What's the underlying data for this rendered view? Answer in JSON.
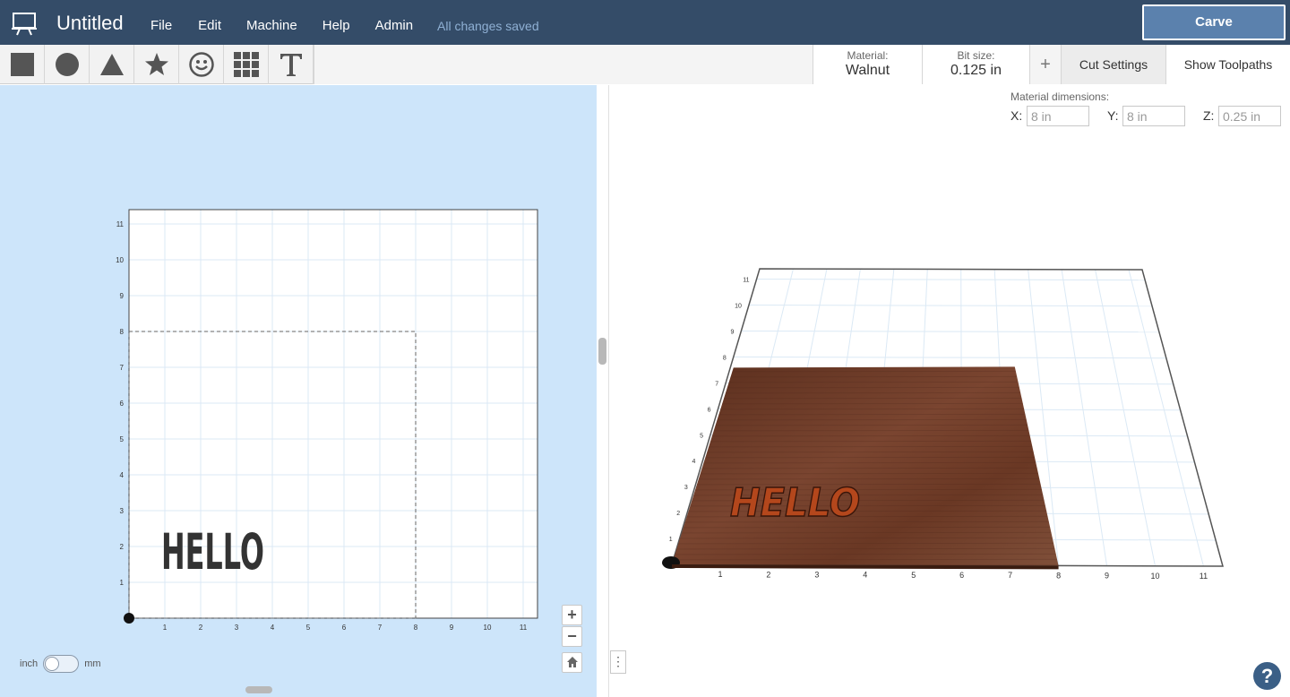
{
  "app": {
    "title": "Untitled",
    "icon": "easel-icon",
    "save_status": "All changes saved",
    "carve_label": "Carve"
  },
  "menu": [
    {
      "label": "File"
    },
    {
      "label": "Edit"
    },
    {
      "label": "Machine"
    },
    {
      "label": "Help"
    },
    {
      "label": "Admin"
    }
  ],
  "toolbar": {
    "shapes": [
      "square-icon",
      "circle-icon",
      "triangle-icon",
      "star-icon",
      "smiley-icon",
      "grid-icon",
      "text-icon"
    ],
    "material_label": "Material:",
    "material_value": "Walnut",
    "bit_label": "Bit size:",
    "bit_value": "0.125 in",
    "add_label": "+",
    "cut_settings_label": "Cut Settings",
    "show_toolpaths_label": "Show Toolpaths"
  },
  "design": {
    "text": "HELLO",
    "x_ticks": [
      "1",
      "2",
      "3",
      "4",
      "5",
      "6",
      "7",
      "8",
      "9",
      "10",
      "11"
    ],
    "y_ticks": [
      "1",
      "2",
      "3",
      "4",
      "5",
      "6",
      "7",
      "8",
      "9",
      "10",
      "11"
    ],
    "work_area": {
      "width": 11,
      "height": 11
    },
    "material_size": {
      "x": 8,
      "y": 8
    }
  },
  "zoom": {
    "in_label": "+",
    "out_label": "−"
  },
  "units": {
    "left": "inch",
    "right": "mm",
    "selected": "inch"
  },
  "dimensions": {
    "label": "Material dimensions:",
    "x_label": "X:",
    "x_value": "8 in",
    "y_label": "Y:",
    "y_value": "8 in",
    "z_label": "Z:",
    "z_value": "0.25 in"
  },
  "preview3d": {
    "x_ticks": [
      "1",
      "2",
      "3",
      "4",
      "5",
      "6",
      "7",
      "8",
      "9",
      "10",
      "11"
    ],
    "y_ticks": [
      "1",
      "2",
      "3",
      "4",
      "5",
      "6",
      "7",
      "8",
      "9",
      "10",
      "11"
    ]
  },
  "help_label": "?",
  "panel_toggle_label": "⋮",
  "colors": {
    "topbar": "#344c68",
    "carve": "#5b81ad",
    "canvas_bg": "#cde5fa",
    "wood": "#6b3a25",
    "grid": "#dbe9f5"
  }
}
